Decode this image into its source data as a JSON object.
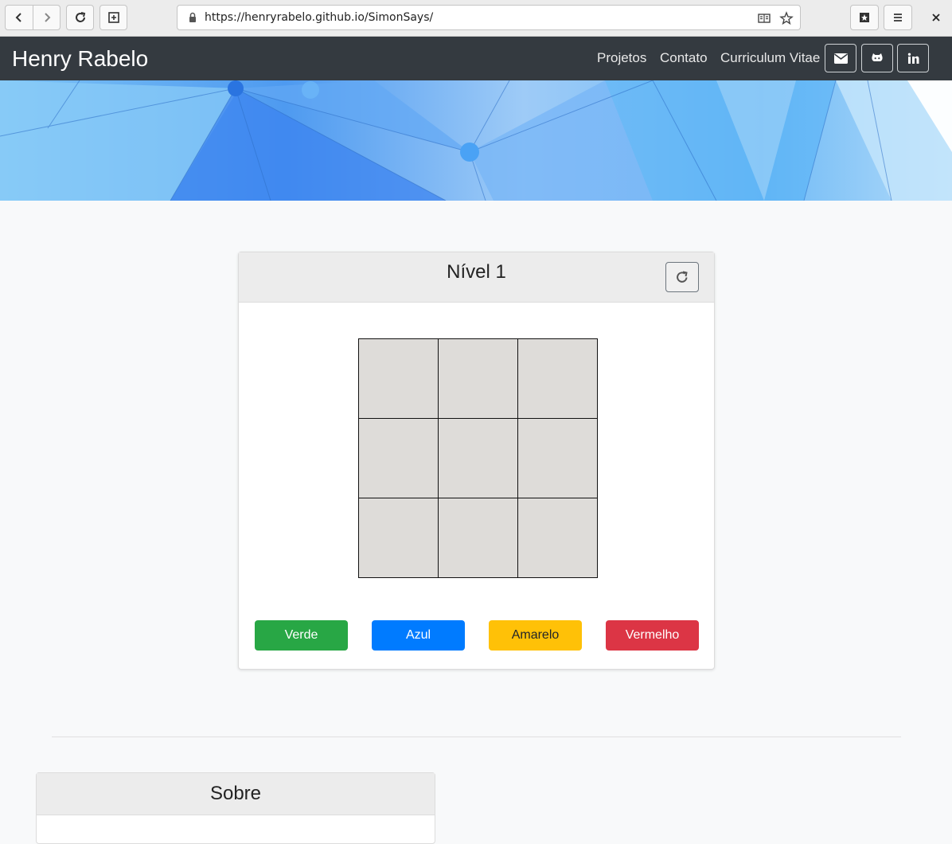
{
  "browser": {
    "url": "https://henryrabelo.github.io/SimonSays/",
    "back_icon": "chevron-left-icon",
    "forward_icon": "chevron-right-icon",
    "reload_icon": "reload-icon",
    "new_tab_icon": "new-tab-icon",
    "reader_icon": "reader-mode-icon",
    "bookmark_icon": "star-icon",
    "archive_icon": "archive-icon",
    "menu_icon": "hamburger-menu-icon",
    "close_icon": "close-icon"
  },
  "navbar": {
    "brand": "Henry Rabelo",
    "links": [
      "Projetos",
      "Contato",
      "Curriculum Vitae"
    ],
    "social_icons": [
      "envelope-icon",
      "github-icon",
      "linkedin-icon"
    ]
  },
  "game": {
    "level_title": "Nível 1",
    "reset_icon": "refresh-icon",
    "buttons": [
      {
        "label": "Verde",
        "color": "#28a745"
      },
      {
        "label": "Azul",
        "color": "#007bff"
      },
      {
        "label": "Amarelo",
        "color": "#ffc107"
      },
      {
        "label": "Vermelho",
        "color": "#dc3545"
      }
    ],
    "cell_color": "#dedcd9"
  },
  "about": {
    "title": "Sobre"
  },
  "colors": {
    "navbar_bg": "#343a40",
    "page_bg": "#f8f9fa"
  }
}
